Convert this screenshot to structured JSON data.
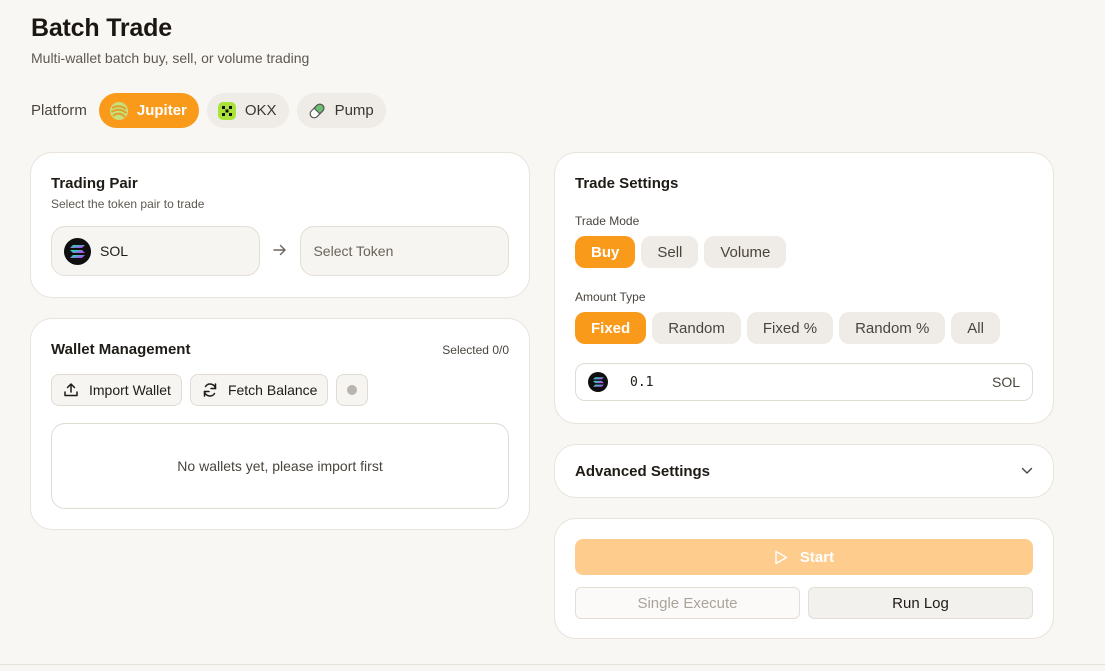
{
  "header": {
    "title": "Batch Trade",
    "subtitle": "Multi-wallet batch buy, sell, or volume trading"
  },
  "platform": {
    "label": "Platform",
    "options": [
      {
        "label": "Jupiter",
        "icon": "jupiter-icon",
        "active": true
      },
      {
        "label": "OKX",
        "icon": "okx-icon",
        "active": false
      },
      {
        "label": "Pump",
        "icon": "pump-pill-icon",
        "active": false
      }
    ]
  },
  "trading_pair": {
    "title": "Trading Pair",
    "subtitle": "Select the token pair to trade",
    "from_token": "SOL",
    "to_token_placeholder": "Select Token"
  },
  "wallet": {
    "title": "Wallet Management",
    "selected_text": "Selected 0/0",
    "import_label": "Import Wallet",
    "fetch_label": "Fetch Balance",
    "empty_text": "No wallets yet, please import first"
  },
  "settings": {
    "title": "Trade Settings",
    "mode_label": "Trade Mode",
    "modes": [
      {
        "label": "Buy",
        "active": true
      },
      {
        "label": "Sell",
        "active": false
      },
      {
        "label": "Volume",
        "active": false
      }
    ],
    "amount_type_label": "Amount Type",
    "amount_types": [
      {
        "label": "Fixed",
        "active": true
      },
      {
        "label": "Random",
        "active": false
      },
      {
        "label": "Fixed %",
        "active": false
      },
      {
        "label": "Random %",
        "active": false
      },
      {
        "label": "All",
        "active": false
      }
    ],
    "amount_value": "0.1",
    "amount_unit": "SOL"
  },
  "advanced": {
    "title": "Advanced Settings"
  },
  "run": {
    "start_label": "Start",
    "single_label": "Single Execute",
    "log_label": "Run Log"
  },
  "colors": {
    "accent": "#fa9a1b",
    "accent_disabled": "#fecc8d",
    "background": "#f9f7f3"
  }
}
